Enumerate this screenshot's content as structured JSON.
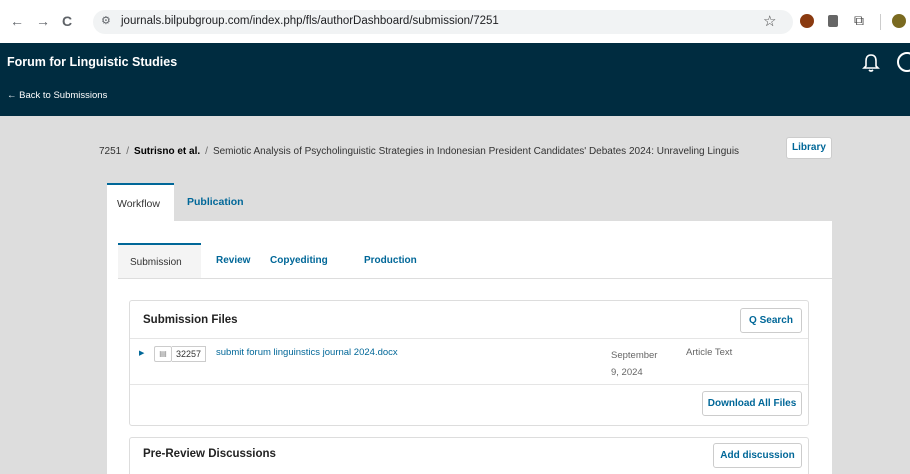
{
  "browser": {
    "back_icon": "←",
    "forward_icon": "→",
    "reload_icon": "C",
    "site_icon": "tune-icon",
    "url": "journals.bilpubgroup.com/index.php/fls/authorDashboard/submission/7251"
  },
  "header": {
    "journal_title": "Forum for Linguistic Studies",
    "back_link": "← Back to Submissions",
    "background_color": "#002c40"
  },
  "breadcrumb": {
    "id": "7251",
    "separator": "/",
    "authors": "Sutrisno et al.",
    "title": "Semiotic Analysis of Psycholinguistic Strategies in Indonesian President Candidates' Debates 2024: Unraveling Linguis"
  },
  "library_button": "Library",
  "main_tabs": [
    {
      "label": "Workflow",
      "active": true
    },
    {
      "label": "Publication",
      "active": false
    }
  ],
  "stage_tabs": [
    {
      "label": "Submission",
      "active": true
    },
    {
      "label": "Review",
      "active": false
    },
    {
      "label": "Copyediting",
      "active": false
    },
    {
      "label": "Production",
      "active": false
    }
  ],
  "submission_files": {
    "title": "Submission Files",
    "search_button": "Q  Search",
    "files": [
      {
        "id": "32257",
        "name": "submit forum linguinstics journal 2024.docx",
        "date": "September 9, 2024",
        "type": "Article Text"
      }
    ],
    "download_button": "Download All Files"
  },
  "pre_review": {
    "title": "Pre-Review Discussions",
    "add_button": "Add discussion"
  },
  "accent_color": "#006798"
}
